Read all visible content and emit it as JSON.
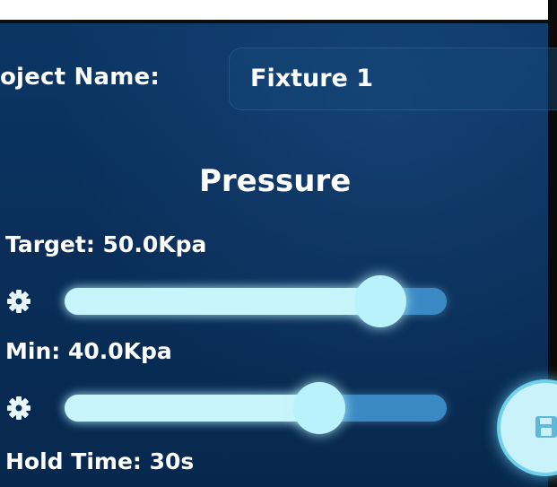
{
  "project": {
    "label": "oject Name:",
    "value": "Fixture 1"
  },
  "section": {
    "title": "Pressure"
  },
  "params": [
    {
      "label": "Target: 50.0Kpa",
      "level_fraction": 0.84,
      "icon": "gear-icon"
    },
    {
      "label": "Min: 40.0Kpa",
      "level_fraction": 0.68,
      "icon": "gear-icon"
    },
    {
      "label": "Hold Time: 30s"
    }
  ],
  "save_button": {
    "icon": "save-icon"
  },
  "colors": {
    "background": "#0a2f5a",
    "slider_fill": "#c8f4fb",
    "slider_track": "#3a89c4",
    "text": "#ffffff"
  }
}
